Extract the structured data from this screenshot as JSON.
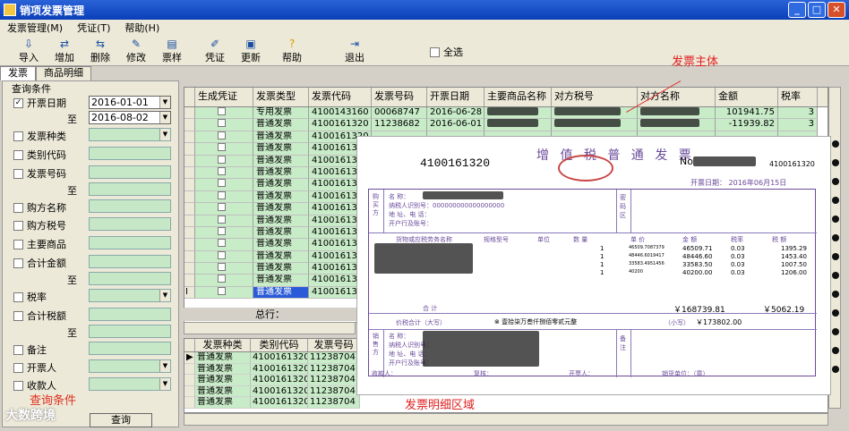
{
  "window": {
    "title": "销项发票管理"
  },
  "menu": [
    "发票管理(M)",
    "凭证(T)",
    "帮助(H)"
  ],
  "toolbar": {
    "items": [
      {
        "label": "导入",
        "icon": "import-icon"
      },
      {
        "label": "增加",
        "icon": "add-icon"
      },
      {
        "label": "删除",
        "icon": "delete-icon"
      },
      {
        "label": "修改",
        "icon": "edit-icon"
      },
      {
        "label": "票样",
        "icon": "sample-icon"
      },
      {
        "label": "凭证",
        "icon": "voucher-icon"
      },
      {
        "label": "更新",
        "icon": "refresh-icon"
      },
      {
        "label": "帮助",
        "icon": "help-icon"
      },
      {
        "label": "退出",
        "icon": "exit-icon"
      }
    ],
    "select_all": "全选"
  },
  "tabs": [
    "发票",
    "商品明细"
  ],
  "query": {
    "title": "查询条件",
    "fields": [
      {
        "label": "开票日期",
        "checked": true,
        "value": "2016-01-01"
      },
      {
        "label": "至",
        "value": "2016-08-02"
      },
      {
        "label": "发票种类"
      },
      {
        "label": "类别代码"
      },
      {
        "label": "发票号码"
      },
      {
        "label": "至"
      },
      {
        "label": "购方名称"
      },
      {
        "label": "购方税号"
      },
      {
        "label": "主要商品"
      },
      {
        "label": "合计金额"
      },
      {
        "label": "至"
      },
      {
        "label": "税率"
      },
      {
        "label": "合计税额"
      },
      {
        "label": "至"
      },
      {
        "label": "备注"
      },
      {
        "label": "开票人"
      },
      {
        "label": "收款人"
      }
    ],
    "button": "查询",
    "annotation": "查询条件"
  },
  "grid": {
    "headers": [
      "生成凭证",
      "发票类型",
      "发票代码",
      "发票号码",
      "开票日期",
      "主要商品名称",
      "对方税号",
      "对方名称",
      "金额",
      "税率"
    ],
    "rows": [
      {
        "type": "专用发票",
        "code": "4100143160",
        "number": "00068747",
        "date": "2016-06-28",
        "amount": "101941.75",
        "rate": "3"
      },
      {
        "type": "普通发票",
        "code": "4100161320",
        "number": "11238682",
        "date": "2016-06-01",
        "amount": "-11939.82",
        "rate": "3"
      },
      {
        "type": "普通发票",
        "code": "4100161320"
      },
      {
        "type": "普通发票",
        "code": "4100161320"
      },
      {
        "type": "普通发票",
        "code": "4100161320"
      },
      {
        "type": "普通发票",
        "code": "4100161320"
      },
      {
        "type": "普通发票",
        "code": "4100161320"
      },
      {
        "type": "普通发票",
        "code": "4100161320"
      },
      {
        "type": "普通发票",
        "code": "4100161320"
      },
      {
        "type": "普通发票",
        "code": "4100161320"
      },
      {
        "type": "普通发票",
        "code": "4100161320"
      },
      {
        "type": "普通发票",
        "code": "4100161320"
      },
      {
        "type": "普通发票",
        "code": "4100161320"
      },
      {
        "type": "普通发票",
        "code": "4100161320"
      },
      {
        "type": "普通发票",
        "code": "4100161320"
      },
      {
        "type": "普通发票",
        "code": "4100161320"
      }
    ],
    "total_label": "总行：",
    "annotation": "发票主体"
  },
  "detail": {
    "headers": [
      "发票种类",
      "类别代码",
      "发票号码"
    ],
    "rows": [
      {
        "type": "普通发票",
        "code": "4100161320",
        "number": "11238704"
      },
      {
        "type": "普通发票",
        "code": "4100161320",
        "number": "11238704"
      },
      {
        "type": "普通发票",
        "code": "4100161320",
        "number": "11238704"
      },
      {
        "type": "普通发票",
        "code": "4100161320",
        "number": "11238704"
      },
      {
        "type": "普通发票",
        "code": "4100161320",
        "number": "11238704"
      }
    ],
    "annotation": "发票明细区域"
  },
  "invoice": {
    "code": "4100161320",
    "title": "增 值 税 普 通 发 票",
    "no_label": "No",
    "no_code": "4100161320",
    "date": "开票日期：  2016年06月15日",
    "buyer": {
      "name": "名    称：",
      "taxid": "纳税人识别号：000000000000000000",
      "addr": "地 址、电 话：",
      "bank": "开户行及账号："
    },
    "cols": {
      "goods": "货物或应税劳务名称",
      "spec": "规格型号",
      "unit": "单位",
      "qty": "数 量",
      "price": "单 价",
      "amount": "金 额",
      "rate": "税率",
      "tax": "税 额"
    },
    "lines": [
      {
        "qty": "1",
        "price": "46509.7087379",
        "amount": "46509.71",
        "rate": "0.03",
        "tax": "1395.29"
      },
      {
        "qty": "1",
        "price": "48446.6019417",
        "amount": "48446.60",
        "rate": "0.03",
        "tax": "1453.40"
      },
      {
        "qty": "1",
        "price": "33583.4951456",
        "amount": "33583.50",
        "rate": "0.03",
        "tax": "1007.50"
      },
      {
        "qty": "1",
        "price": "40200",
        "amount": "40200.00",
        "rate": "0.03",
        "tax": "1206.00"
      }
    ],
    "total_label": "合    计",
    "total_amount": "￥168739.81",
    "total_tax": "￥5062.19",
    "sum_label": "价税合计（大写）",
    "sum_text": "⊗ 壹拾柒万叁仟捌佰零贰元整",
    "sum_small": "（小写）",
    "sum_value": "￥173802.00",
    "seller": {
      "name": "名    称：",
      "taxid": "纳税人识别号：",
      "addr": "地 址、电 话：",
      "bank": "开户行及账号："
    },
    "payee": "收款人：",
    "reviewer": "复核：",
    "drawer": "开票人：",
    "stamp": "销货单位：（章）",
    "side_labels": {
      "buyer": "购买方",
      "seller": "销售方",
      "password": "密码区",
      "remark": "备注"
    }
  },
  "watermark": "大数跨境"
}
